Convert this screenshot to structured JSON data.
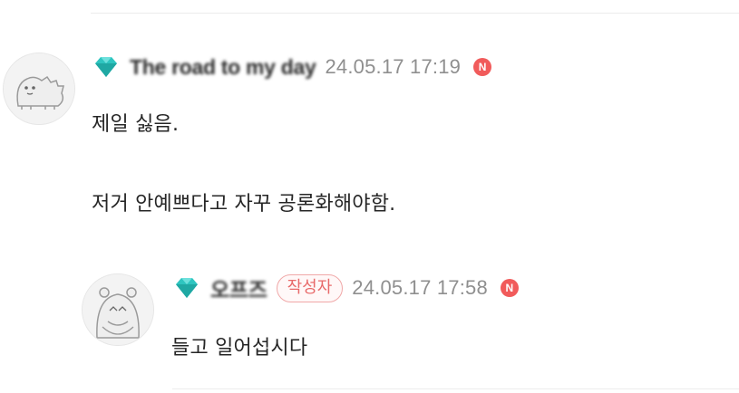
{
  "colors": {
    "gem": "#2ec5c0",
    "timestamp": "#8f8f8f",
    "notice_badge": "#f15b5b",
    "author_badge": "#e86a6a"
  },
  "comment": {
    "avatar_icon": "dinosaur-avatar",
    "nickname": "The road to my day",
    "timestamp": "24.05.17 17:19",
    "notice_badge": "N",
    "lines": [
      "제일 싫음.",
      "저거 안예쁘다고 자꾸 공론화해야함."
    ]
  },
  "reply": {
    "avatar_icon": "hippo-avatar",
    "nickname": "오프즈",
    "author_label": "작성자",
    "timestamp": "24.05.17 17:58",
    "notice_badge": "N",
    "lines": [
      "들고 일어섭시다"
    ]
  }
}
